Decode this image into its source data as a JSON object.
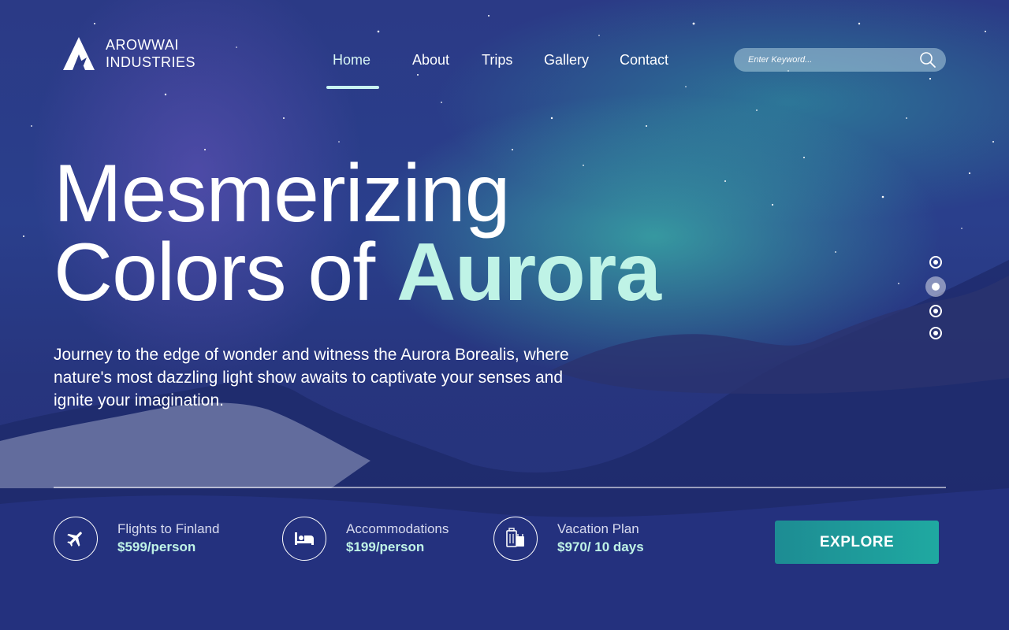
{
  "brand": {
    "line1": "AROWWAI",
    "line2": "INDUSTRIES"
  },
  "nav": {
    "items": [
      {
        "label": "Home",
        "active": true
      },
      {
        "label": "About",
        "active": false
      },
      {
        "label": "Trips",
        "active": false
      },
      {
        "label": "Gallery",
        "active": false
      },
      {
        "label": "Contact",
        "active": false
      }
    ]
  },
  "search": {
    "placeholder": "Enter Keyword..."
  },
  "hero": {
    "line1": "Mesmerizing",
    "line2_prefix": "Colors of",
    "line2_accent": "Aurora",
    "description": "Journey to the edge of wonder and witness the Aurora Borealis, where nature's most dazzling light show awaits to captivate your senses and ignite your imagination."
  },
  "slider": {
    "count": 4,
    "active_index": 1
  },
  "offers": [
    {
      "icon": "airplane-icon",
      "label": "Flights to Finland",
      "price": "$599/person"
    },
    {
      "icon": "bed-icon",
      "label": "Accommodations",
      "price": "$199/person"
    },
    {
      "icon": "luggage-icon",
      "label": "Vacation Plan",
      "price": "$970/ 10 days"
    }
  ],
  "cta": {
    "label": "EXPLORE"
  },
  "colors": {
    "accent": "#bff3e6",
    "button": "#1fa9a1",
    "background": "#2a3a86"
  }
}
